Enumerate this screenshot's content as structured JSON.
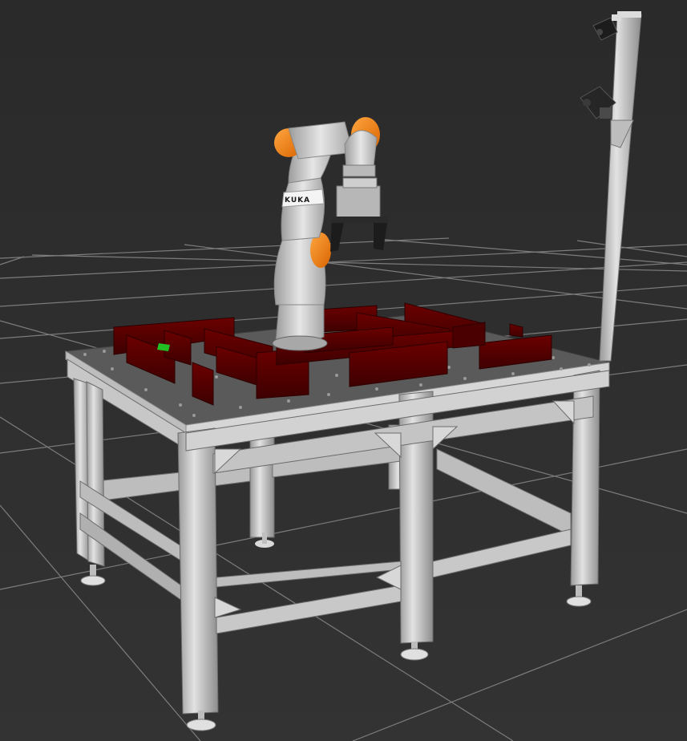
{
  "scene": {
    "background_color": "#303030",
    "grid_color": "#8a8a8a",
    "table_top_color": "#565656",
    "frame_color": "#c9c9c9",
    "wall_color": "#5a0000",
    "arm_body_color": "#c8c8c8",
    "arm_joint_color": "#ff7f00",
    "target_color": "#22c022"
  },
  "robot": {
    "brand_label": "KUKA"
  }
}
